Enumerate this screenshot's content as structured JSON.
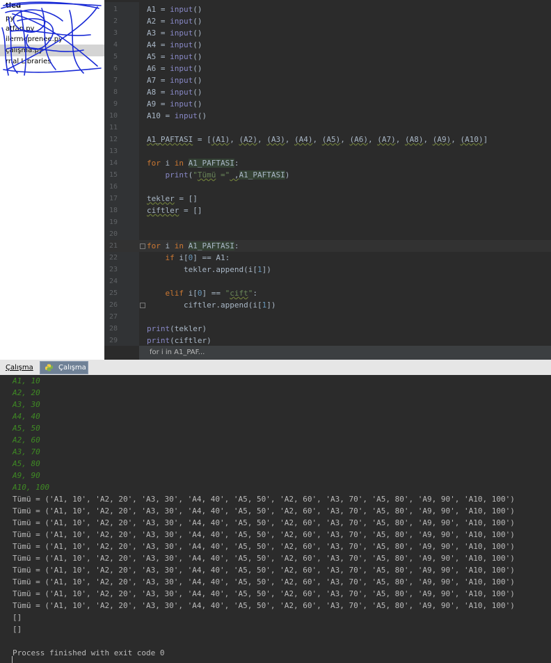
{
  "sidebar": {
    "items": [
      "tled",
      "py",
      "atfan.py",
      "ilermeprenee.py",
      "çalışma.py",
      "rnal Libraries"
    ]
  },
  "editor": {
    "lines": [
      {
        "n": "1",
        "html": "A1 = <span class=\"bi\">input</span>()"
      },
      {
        "n": "2",
        "html": "A2 = <span class=\"bi\">input</span>()"
      },
      {
        "n": "3",
        "html": "A3 = <span class=\"bi\">input</span>()"
      },
      {
        "n": "4",
        "html": "A4 = <span class=\"bi\">input</span>()"
      },
      {
        "n": "5",
        "html": "A5 = <span class=\"bi\">input</span>()"
      },
      {
        "n": "6",
        "html": "A6 = <span class=\"bi\">input</span>()"
      },
      {
        "n": "7",
        "html": "A7 = <span class=\"bi\">input</span>()"
      },
      {
        "n": "8",
        "html": "A8 = <span class=\"bi\">input</span>()"
      },
      {
        "n": "9",
        "html": "A9 = <span class=\"bi\">input</span>()"
      },
      {
        "n": "10",
        "html": "A10 = <span class=\"bi\">input</span>()"
      },
      {
        "n": "11",
        "html": ""
      },
      {
        "n": "12",
        "html": "<span class=\"sq\">A1_PAFTASI</span> = [<span class=\"sq\">(A1)</span>, <span class=\"sq\">(A2)</span>, <span class=\"sq\">(A3)</span>, <span class=\"sq\">(A4)</span>, <span class=\"sq\">(A5)</span>, <span class=\"sq\">(A6)</span>, <span class=\"sq\">(A7)</span>, <span class=\"sq\">(A8)</span>, <span class=\"sq\">(A9)</span>, <span class=\"sq\">(A10)</span>]"
      },
      {
        "n": "13",
        "html": ""
      },
      {
        "n": "14",
        "html": "<span class=\"kw\">for</span> i <span class=\"kw\">in</span> <span class=\"hi\">A1_PAFTASI</span>:"
      },
      {
        "n": "15",
        "html": "    <span class=\"bi\">print</span>(<span class=\"str\">\"<span class=\"sq\">Tümü</span> =\"</span><span class=\"sq\"> ,</span><span class=\"hi\">A1_PAFTASI</span>)"
      },
      {
        "n": "16",
        "html": ""
      },
      {
        "n": "17",
        "html": "<span class=\"sq\">tekler</span> = []"
      },
      {
        "n": "18",
        "html": "<span class=\"sq\">ciftler</span> = []"
      },
      {
        "n": "19",
        "html": ""
      },
      {
        "n": "20",
        "html": ""
      },
      {
        "n": "21",
        "html": "<span class=\"kw\">for</span> i <span class=\"kw\">in</span> <span class=\"hi\">A1_PAFTASI</span>:",
        "hl": true,
        "fold": true
      },
      {
        "n": "22",
        "html": "    <span class=\"kw\">if</span> i[<span class=\"num\">0</span>] == A1:"
      },
      {
        "n": "23",
        "html": "        tekler.append(i[<span class=\"num\">1</span>])"
      },
      {
        "n": "24",
        "html": ""
      },
      {
        "n": "25",
        "html": "    <span class=\"kw\">elif</span> i[<span class=\"num\">0</span>] == <span class=\"str\">\"<span class=\"sq\">cift</span>\"</span>:"
      },
      {
        "n": "26",
        "html": "        ciftler.append(i[<span class=\"num\">1</span>])",
        "fold": true
      },
      {
        "n": "27",
        "html": ""
      },
      {
        "n": "28",
        "html": "<span class=\"bi\">print</span>(tekler)"
      },
      {
        "n": "29",
        "html": "<span class=\"bi\">print</span>(ciftler)"
      }
    ],
    "breadcrumb": "for i in A1_PAF..."
  },
  "run_panel": {
    "tab_label": "Çalışma",
    "tab_active_label": "Çalışma"
  },
  "console": {
    "inputs": [
      "A1, 10",
      "A2, 20",
      "A3, 30",
      "A4, 40",
      "A5, 50",
      "A2, 60",
      "A3, 70",
      "A5, 80",
      "A9, 90",
      "A10, 100"
    ],
    "outputs": [
      "Tümü = ('A1, 10', 'A2, 20', 'A3, 30', 'A4, 40', 'A5, 50', 'A2, 60', 'A3, 70', 'A5, 80', 'A9, 90', 'A10, 100')",
      "Tümü = ('A1, 10', 'A2, 20', 'A3, 30', 'A4, 40', 'A5, 50', 'A2, 60', 'A3, 70', 'A5, 80', 'A9, 90', 'A10, 100')",
      "Tümü = ('A1, 10', 'A2, 20', 'A3, 30', 'A4, 40', 'A5, 50', 'A2, 60', 'A3, 70', 'A5, 80', 'A9, 90', 'A10, 100')",
      "Tümü = ('A1, 10', 'A2, 20', 'A3, 30', 'A4, 40', 'A5, 50', 'A2, 60', 'A3, 70', 'A5, 80', 'A9, 90', 'A10, 100')",
      "Tümü = ('A1, 10', 'A2, 20', 'A3, 30', 'A4, 40', 'A5, 50', 'A2, 60', 'A3, 70', 'A5, 80', 'A9, 90', 'A10, 100')",
      "Tümü = ('A1, 10', 'A2, 20', 'A3, 30', 'A4, 40', 'A5, 50', 'A2, 60', 'A3, 70', 'A5, 80', 'A9, 90', 'A10, 100')",
      "Tümü = ('A1, 10', 'A2, 20', 'A3, 30', 'A4, 40', 'A5, 50', 'A2, 60', 'A3, 70', 'A5, 80', 'A9, 90', 'A10, 100')",
      "Tümü = ('A1, 10', 'A2, 20', 'A3, 30', 'A4, 40', 'A5, 50', 'A2, 60', 'A3, 70', 'A5, 80', 'A9, 90', 'A10, 100')",
      "Tümü = ('A1, 10', 'A2, 20', 'A3, 30', 'A4, 40', 'A5, 50', 'A2, 60', 'A3, 70', 'A5, 80', 'A9, 90', 'A10, 100')",
      "Tümü = ('A1, 10', 'A2, 20', 'A3, 30', 'A4, 40', 'A5, 50', 'A2, 60', 'A3, 70', 'A5, 80', 'A9, 90', 'A10, 100')",
      "[]",
      "[]",
      "",
      "Process finished with exit code 0"
    ]
  },
  "colors": {
    "editor_bg": "#2b2b2b",
    "keyword": "#cc7832",
    "builtin": "#8888c6",
    "string": "#6a8759",
    "number": "#6897bb",
    "console_input": "#3f8a24",
    "scribble": "#1a2bd6"
  }
}
